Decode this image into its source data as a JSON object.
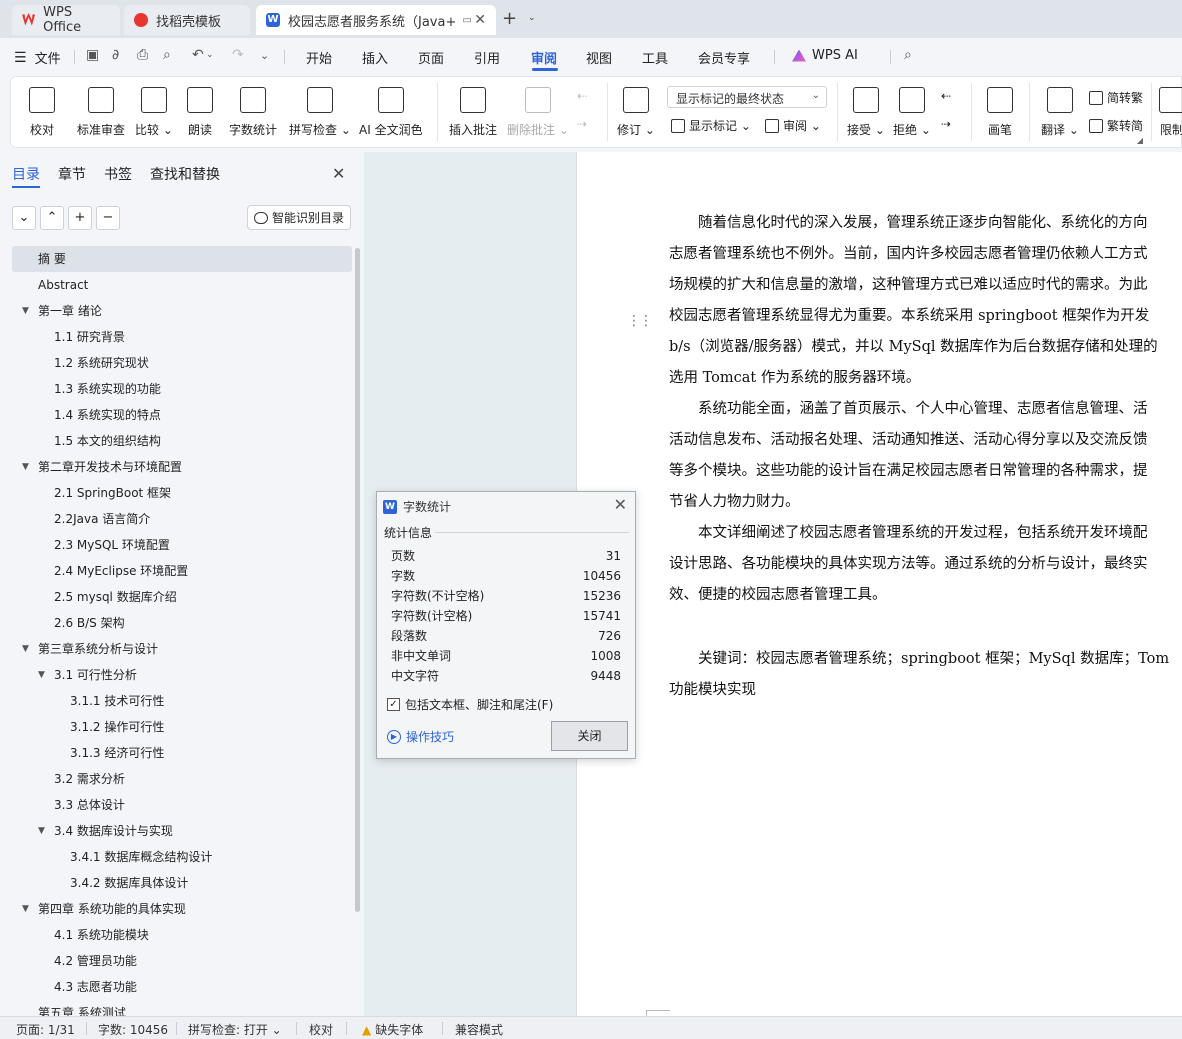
{
  "tabs": [
    {
      "label": "WPS Office"
    },
    {
      "label": "找稻壳模板"
    },
    {
      "label": "校园志愿者服务系统（Java+"
    }
  ],
  "menu": {
    "file": "文件",
    "items": [
      "开始",
      "插入",
      "页面",
      "引用",
      "审阅",
      "视图",
      "工具",
      "会员专享"
    ],
    "active": "审阅",
    "ai": "WPS AI"
  },
  "ribbon": {
    "proofread": "校对",
    "standard_review": "标准审查",
    "compare": "比较",
    "read_aloud": "朗读",
    "word_count": "字数统计",
    "spell_check": "拼写检查",
    "ai_polish": "AI 全文润色",
    "insert_comment": "插入批注",
    "delete_comment": "删除批注",
    "track_changes": "修订",
    "markup_select": "显示标记的最终状态",
    "show_markup": "显示标记",
    "review_pane": "审阅",
    "accept": "接受",
    "reject": "拒绝",
    "pen": "画笔",
    "translate": "翻译",
    "to_trad": "简转繁",
    "to_simp": "繁转简",
    "restrict": "限制"
  },
  "nav": {
    "tabs": [
      "目录",
      "章节",
      "书签",
      "查找和替换"
    ],
    "smart_toc": "智能识别目录",
    "toc": [
      {
        "text": "摘  要",
        "level": 0,
        "arrow": false
      },
      {
        "text": "Abstract",
        "level": 0,
        "arrow": false
      },
      {
        "text": "第一章  绪论",
        "level": 0,
        "arrow": true
      },
      {
        "text": "1.1    研究背景",
        "level": 1,
        "arrow": false
      },
      {
        "text": "1.2    系统研究现状",
        "level": 1,
        "arrow": false
      },
      {
        "text": "1.3    系统实现的功能",
        "level": 1,
        "arrow": false
      },
      {
        "text": "1.4 系统实现的特点",
        "level": 1,
        "arrow": false
      },
      {
        "text": "1.5    本文的组织结构",
        "level": 1,
        "arrow": false
      },
      {
        "text": "第二章开发技术与环境配置",
        "level": 0,
        "arrow": true
      },
      {
        "text": "2.1    SpringBoot 框架",
        "level": 1,
        "arrow": false
      },
      {
        "text": "2.2Java 语言简介",
        "level": 1,
        "arrow": false
      },
      {
        "text": "2.3    MySQL 环境配置",
        "level": 1,
        "arrow": false
      },
      {
        "text": "2.4    MyEclipse 环境配置",
        "level": 1,
        "arrow": false
      },
      {
        "text": "2.5    mysql 数据库介绍",
        "level": 1,
        "arrow": false
      },
      {
        "text": "2.6    B/S 架构",
        "level": 1,
        "arrow": false
      },
      {
        "text": "第三章系统分析与设计",
        "level": 0,
        "arrow": true
      },
      {
        "text": "3.1  可行性分析",
        "level": 1,
        "arrow": true
      },
      {
        "text": "3.1.1  技术可行性",
        "level": 2,
        "arrow": false
      },
      {
        "text": "3.1.2  操作可行性",
        "level": 2,
        "arrow": false
      },
      {
        "text": "3.1.3 经济可行性",
        "level": 2,
        "arrow": false
      },
      {
        "text": "3.2    需求分析",
        "level": 1,
        "arrow": false
      },
      {
        "text": "3.3    总体设计",
        "level": 1,
        "arrow": false
      },
      {
        "text": "3.4    数据库设计与实现",
        "level": 1,
        "arrow": true
      },
      {
        "text": "3.4.1    数据库概念结构设计",
        "level": 2,
        "arrow": false
      },
      {
        "text": "3.4.2 数据库具体设计",
        "level": 2,
        "arrow": false
      },
      {
        "text": "第四章   系统功能的具体实现",
        "level": 0,
        "arrow": true
      },
      {
        "text": "4.1 系统功能模块",
        "level": 1,
        "arrow": false
      },
      {
        "text": "4.2 管理员功能",
        "level": 1,
        "arrow": false
      },
      {
        "text": "4.3 志愿者功能",
        "level": 1,
        "arrow": false
      },
      {
        "text": "第五章  系统测试",
        "level": 0,
        "arrow": false
      }
    ]
  },
  "document": {
    "lines": [
      "　　随着信息化时代的深入发展，管理系统正逐步向智能化、系统化的方向",
      "志愿者管理系统也不例外。当前，国内许多校园志愿者管理仍依赖人工方式",
      "场规模的扩大和信息量的激增，这种管理方式已难以适应时代的需求。为此",
      "校园志愿者管理系统显得尤为重要。本系统采用 springboot 框架作为开发",
      "b/s（浏览器/服务器）模式，并以 MySql 数据库作为后台数据存储和处理的",
      "选用 Tomcat 作为系统的服务器环境。",
      "　　系统功能全面，涵盖了首页展示、个人中心管理、志愿者信息管理、活",
      "活动信息发布、活动报名处理、活动通知推送、活动心得分享以及交流反馈",
      "等多个模块。这些功能的设计旨在满足校园志愿者日常管理的各种需求，提",
      "节省人力物力财力。",
      "　　本文详细阐述了校园志愿者管理系统的开发过程，包括系统开发环境配",
      "设计思路、各功能模块的具体实现方法等。通过系统的分析与设计，最终实",
      "效、便捷的校园志愿者管理工具。"
    ],
    "keywords_line1": "　　关键词：校园志愿者管理系统；springboot 框架；MySql 数据库；Tom",
    "keywords_line2": "功能模块实现"
  },
  "dialog": {
    "title": "字数统计",
    "group": "统计信息",
    "stats": [
      {
        "label": "页数",
        "value": "31"
      },
      {
        "label": "字数",
        "value": "10456"
      },
      {
        "label": "字符数(不计空格)",
        "value": "15236"
      },
      {
        "label": "字符数(计空格)",
        "value": "15741"
      },
      {
        "label": "段落数",
        "value": "726"
      },
      {
        "label": "非中文单词",
        "value": "1008"
      },
      {
        "label": "中文字符",
        "value": "9448"
      }
    ],
    "include_label": "包括文本框、脚注和尾注(F)",
    "include_checked": true,
    "tips": "操作技巧",
    "close": "关闭"
  },
  "status": {
    "page": "页面: 1/31",
    "words": "字数: 10456",
    "spell": "拼写检查: 打开",
    "proof": "校对",
    "missing_font": "缺失字体",
    "compat": "兼容模式"
  }
}
